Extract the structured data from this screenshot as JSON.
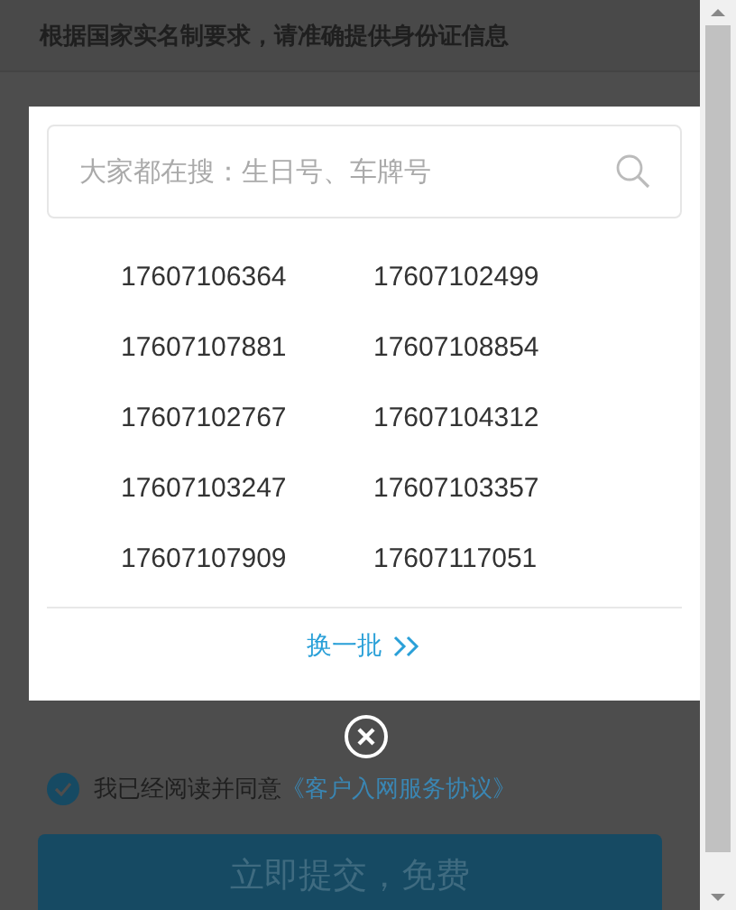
{
  "page": {
    "notice": "根据国家实名制要求，请准确提供身份证信息",
    "agreement": {
      "checked": true,
      "text": "我已经阅读并同意",
      "link": "《客户入网服务协议》"
    },
    "submit_button": "立即提交，免费"
  },
  "modal": {
    "search": {
      "placeholder": "大家都在搜：生日号、车牌号"
    },
    "numbers": [
      "17607106364",
      "17607102499",
      "17607107881",
      "17607108854",
      "17607102767",
      "17607104312",
      "17607103247",
      "17607103357",
      "17607107909",
      "17607117051"
    ],
    "refresh_link": "换一批"
  }
}
